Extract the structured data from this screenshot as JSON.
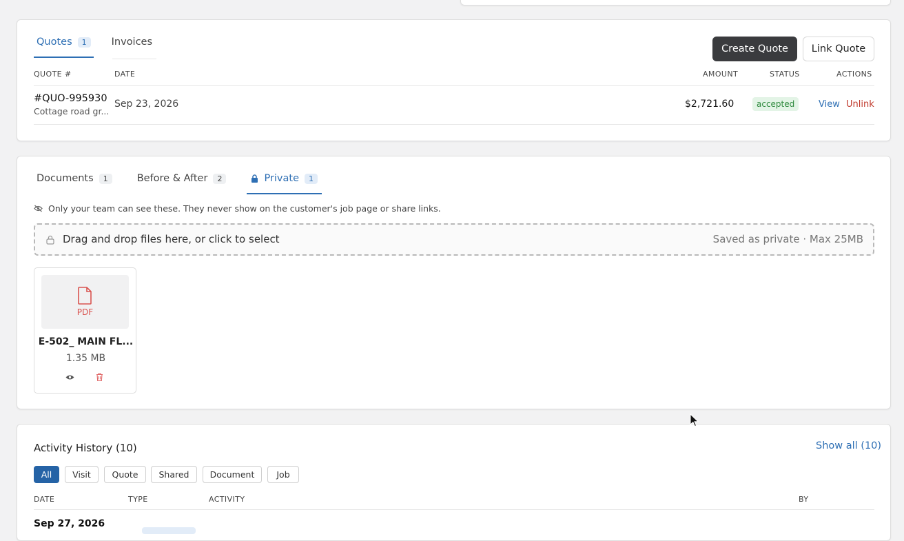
{
  "quotes_section": {
    "tabs": [
      {
        "label": "Quotes",
        "count": "1"
      },
      {
        "label": "Invoices"
      }
    ],
    "buttons": {
      "create": "Create Quote",
      "link": "Link Quote"
    },
    "columns": {
      "number": "QUOTE #",
      "date": "DATE",
      "amount": "AMOUNT",
      "status": "STATUS",
      "actions": "ACTIONS"
    },
    "rows": [
      {
        "number": "#QUO-995930",
        "subtitle": "Cottage road gr...",
        "date": "Sep 23, 2026",
        "amount": "$2,721.60",
        "status": "accepted",
        "view": "View",
        "unlink": "Unlink"
      }
    ]
  },
  "files_section": {
    "tabs": [
      {
        "label": "Documents",
        "count": "1"
      },
      {
        "label": "Before & After",
        "count": "2"
      },
      {
        "label": "Private",
        "count": "1"
      }
    ],
    "notice": "Only your team can see these. They never show on the customer's job page or share links.",
    "dropzone": {
      "text": "Drag and drop files here, or click to select",
      "hint": "Saved as private · Max 25MB"
    },
    "files": [
      {
        "type_label": "PDF",
        "name": "E-502_ MAIN FL...",
        "size": "1.35 MB"
      }
    ]
  },
  "activity_section": {
    "title": "Activity History (10)",
    "show_all": "Show all (10)",
    "filters": [
      "All",
      "Visit",
      "Quote",
      "Shared",
      "Document",
      "Job"
    ],
    "columns": {
      "date": "DATE",
      "type": "TYPE",
      "activity": "ACTIVITY",
      "by": "BY"
    },
    "rows": [
      {
        "date": "Sep 27, 2026"
      }
    ]
  },
  "colors": {
    "accent": "#2e6fb4",
    "danger": "#c0392b",
    "status_accepted": "#2f8a3e",
    "dark_button": "#3a3b3e"
  }
}
